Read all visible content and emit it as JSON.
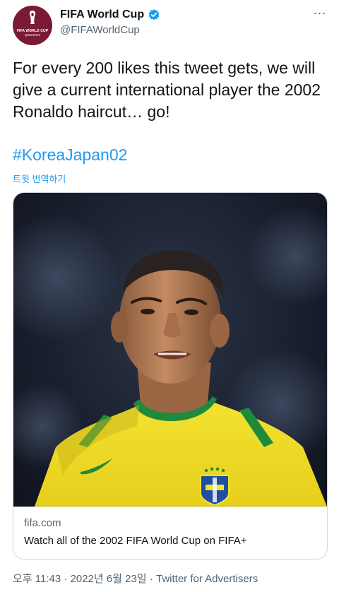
{
  "author": {
    "display_name": "FIFA World Cup",
    "handle": "@FIFAWorldCup",
    "avatar_logo_line1": "FIFA WORLD CUP",
    "avatar_logo_line2": "Qatar2022",
    "verified": true
  },
  "tweet": {
    "text": "For every 200 likes this tweet gets, we will give a current international player the 2002 Ronaldo haircut… go!",
    "hashtag": "#KoreaJapan02",
    "translate_label": "트윗 번역하기"
  },
  "card": {
    "domain": "fifa.com",
    "title": "Watch all of the 2002 FIFA World Cup on FIFA+"
  },
  "meta": {
    "timestamp": "오후 11:43 · 2022년 6월 23일 · Twitter for Advertisers"
  },
  "colors": {
    "link": "#1d9bf0",
    "secondary_text": "#536471",
    "avatar_bg": "#7a1b36",
    "jersey_yellow": "#f5e02a",
    "jersey_green": "#1f8a3c"
  },
  "icons": [
    "verified-badge-icon",
    "more-icon"
  ]
}
